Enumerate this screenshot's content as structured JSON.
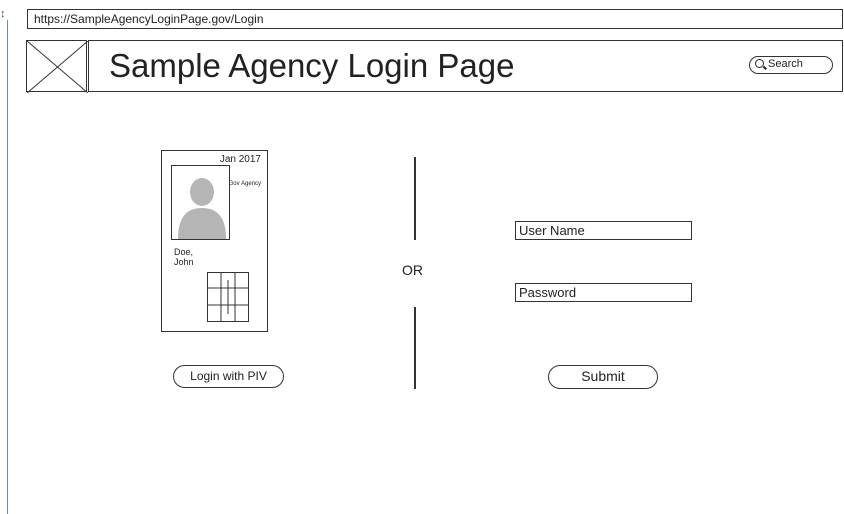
{
  "browser": {
    "url": "https://SampleAgencyLoginPage.gov/Login"
  },
  "header": {
    "title": "Sample Agency Login Page",
    "search_label": "Search"
  },
  "piv_card": {
    "date": "Jan 2017",
    "agency": "Gov Agency",
    "name_last": "Doe,",
    "name_first": "John"
  },
  "piv_login": {
    "button_label": "Login with PIV"
  },
  "separator": {
    "label": "OR"
  },
  "credentials": {
    "username_placeholder": "User Name",
    "password_placeholder": "Password",
    "submit_label": "Submit"
  }
}
